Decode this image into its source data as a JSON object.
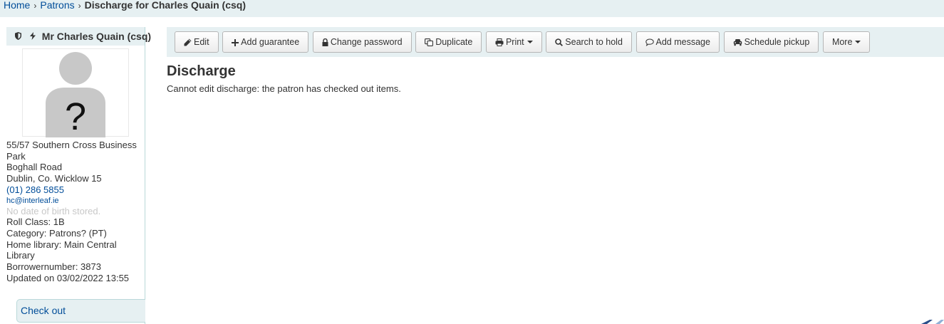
{
  "breadcrumbs": {
    "items": [
      {
        "label": "Home"
      },
      {
        "label": "Patrons"
      }
    ],
    "separator": "›",
    "current": "Discharge for Charles Quain (csq)"
  },
  "patron": {
    "name": "Mr Charles Quain (csq)",
    "status_icons": [
      "shield-icon",
      "bolt-icon"
    ],
    "address": [
      "55/57 Southern Cross Business Park",
      "Boghall Road",
      "Dublin, Co. Wicklow 15"
    ],
    "phone": "(01) 286 5855",
    "email": "hc@interleaf.ie",
    "dob": "No date of birth stored.",
    "roll_class": "Roll Class: 1B",
    "category": "Category: Patrons? (PT)",
    "home_library": "Home library: Main Central Library",
    "borrowernumber": "Borrowernumber: 3873",
    "updated": "Updated on 03/02/2022 13:55"
  },
  "sidebar_nav": {
    "checkout": "Check out"
  },
  "toolbar": {
    "edit": "Edit",
    "add_guarantee": "Add guarantee",
    "change_password": "Change password",
    "duplicate": "Duplicate",
    "print": "Print",
    "search_to_hold": "Search to hold",
    "add_message": "Add message",
    "schedule_pickup": "Schedule pickup",
    "more": "More"
  },
  "main": {
    "heading": "Discharge",
    "message": "Cannot edit discharge: the patron has checked out items."
  },
  "colors": {
    "link": "#004d99",
    "header_bg": "#e6f0f2",
    "border": "#b9d8d9",
    "muted": "#c8c8c8"
  }
}
